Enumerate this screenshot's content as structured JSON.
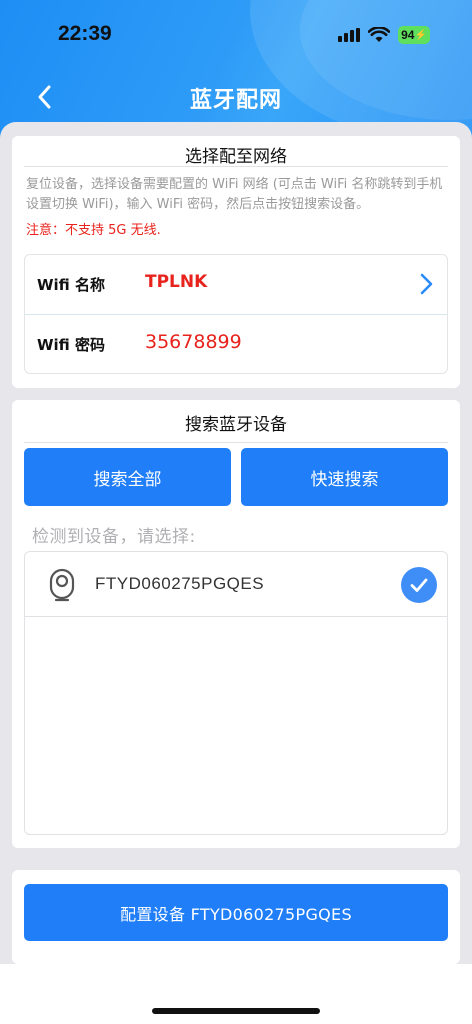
{
  "status_bar": {
    "time": "22:39",
    "battery": "94"
  },
  "nav": {
    "title": "蓝牙配网",
    "back_icon": "chevron-left-icon"
  },
  "network_section": {
    "title": "选择配至网络",
    "description": "复位设备，选择设备需要配置的 WiFi 网络 (可点击 WiFi 名称跳转到手机设置切换 WiFi)，输入 WiFi 密码，然后点击按钮搜索设备。",
    "warning": "注意：不支持 5G 无线.",
    "wifi_name_label": "Wifi 名称",
    "wifi_name_value": "TPLNK",
    "wifi_password_label": "Wifi 密码",
    "wifi_password_value": "35678899"
  },
  "search_section": {
    "title": "搜索蓝牙设备",
    "search_all_label": "搜索全部",
    "quick_search_label": "快速搜索",
    "detected_label": "检测到设备，请选择:",
    "devices": [
      {
        "name": "FTYD060275PGQES",
        "selected": true
      }
    ]
  },
  "config_button_label": "配置设备 FTYD060275PGQES",
  "colors": {
    "accent": "#1f7ef8",
    "warning": "#e8221c",
    "header": "#2190f5"
  }
}
